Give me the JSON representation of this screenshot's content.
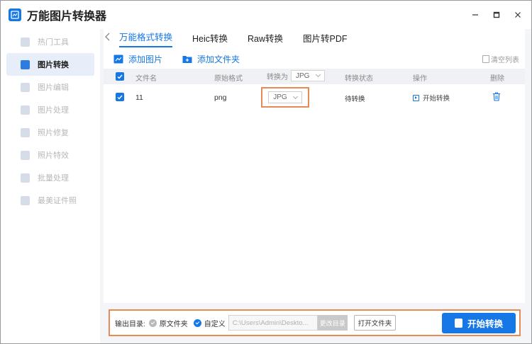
{
  "app": {
    "title": "万能图片转换器"
  },
  "sidebar": {
    "items": [
      {
        "label": "热门工具",
        "icon": "grid-icon"
      },
      {
        "label": "图片转换",
        "icon": "image-convert-icon"
      },
      {
        "label": "图片编辑",
        "icon": "image-edit-icon"
      },
      {
        "label": "图片处理",
        "icon": "image-process-icon"
      },
      {
        "label": "照片修复",
        "icon": "photo-repair-icon"
      },
      {
        "label": "照片特效",
        "icon": "photo-effect-icon"
      },
      {
        "label": "批量处理",
        "icon": "batch-icon"
      },
      {
        "label": "最美证件照",
        "icon": "id-photo-icon"
      }
    ]
  },
  "tabs": [
    "万能格式转换",
    "Heic转换",
    "Raw转换",
    "图片转PDF"
  ],
  "toolbar": {
    "add_image": "添加图片",
    "add_folder": "添加文件夹",
    "clear_list": "清空列表"
  },
  "table": {
    "headers": {
      "filename": "文件名",
      "orig_format": "原始格式",
      "convert_to": "转换为",
      "status": "转换状态",
      "action": "操作",
      "delete": "删除"
    },
    "header_format": "JPG",
    "rows": [
      {
        "filename": "11",
        "orig_format": "png",
        "target": "JPG",
        "status": "待转换",
        "action": "开始转换"
      }
    ]
  },
  "bottom": {
    "output_label": "输出目录:",
    "original_folder": "原文件夹",
    "custom": "自定义",
    "path": "C:\\Users\\Admin\\Deskto...",
    "change_dir": "更改目录",
    "open_folder": "打开文件夹",
    "start": "开始转换"
  },
  "colors": {
    "accent": "#1677e6",
    "highlight": "#e98a56"
  }
}
